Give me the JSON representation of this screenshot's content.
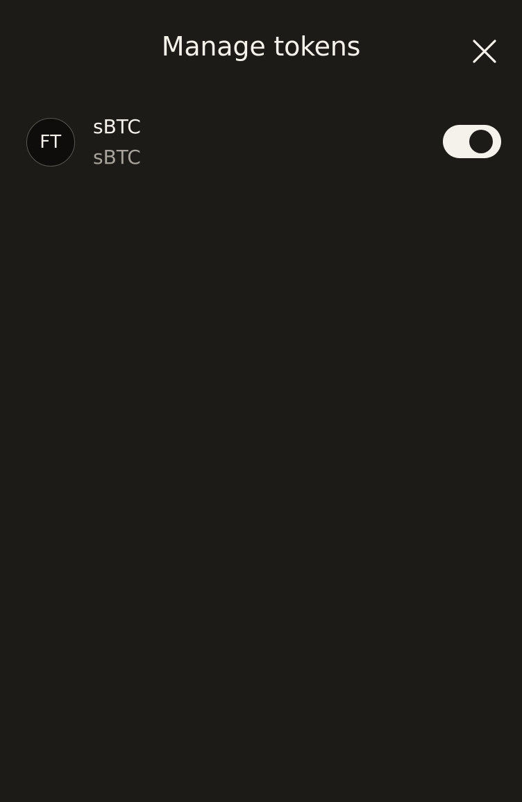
{
  "header": {
    "title": "Manage tokens",
    "close_icon": "close-icon"
  },
  "tokens": [
    {
      "avatar_initials": "FT",
      "name": "sBTC",
      "symbol": "sBTC",
      "enabled": true
    }
  ],
  "colors": {
    "background": "#1c1b18",
    "text_primary": "#f5f2ec",
    "text_secondary": "#a8a49c",
    "toggle_on": "#f5f2ec"
  }
}
